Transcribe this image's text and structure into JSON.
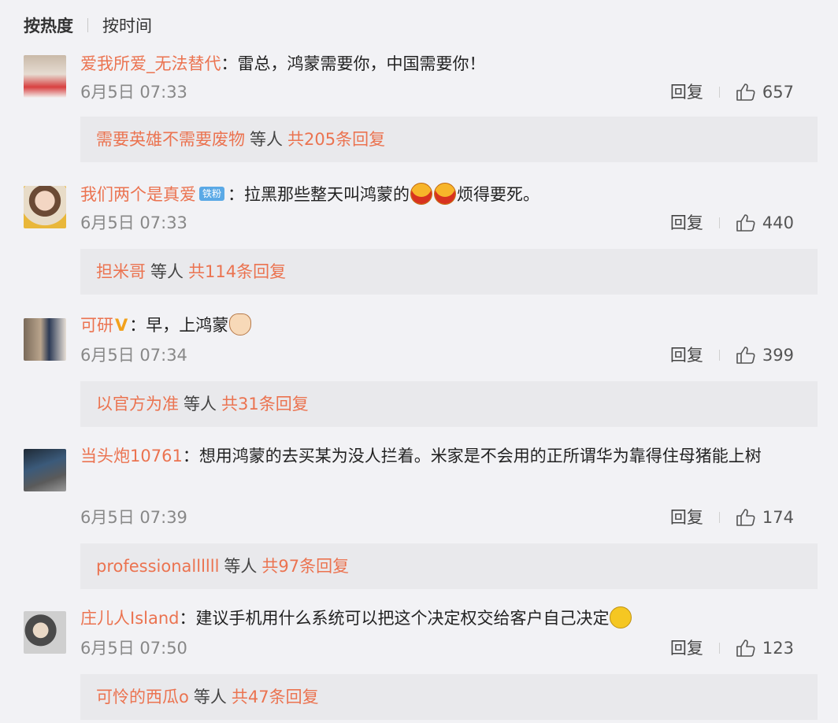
{
  "sort": {
    "hot_label": "按热度",
    "time_label": "按时间"
  },
  "comments": [
    {
      "username": "爱我所爱_无法替代",
      "colon": "：",
      "text": "雷总，鸿蒙需要你，中国需要你！",
      "text_after": "",
      "date": "6月5日 07:33",
      "reply_label": "回复",
      "likes": "657",
      "reply_user": "需要英雄不需要废物",
      "reply_mid": "等人",
      "reply_total": "共205条回复"
    },
    {
      "username": "我们两个是真爱",
      "badge": "铁粉",
      "colon": "：",
      "text": "拉黑那些整天叫鸿蒙的",
      "emojis": [
        "laugh-cry-emoji",
        "laugh-cry-emoji"
      ],
      "text_after": "烦得要死。",
      "date": "6月5日 07:33",
      "reply_label": "回复",
      "likes": "440",
      "reply_user": "担米哥",
      "reply_mid": "等人",
      "reply_total": "共114条回复"
    },
    {
      "username": "可研",
      "colon": "：",
      "text": "早，上鸿蒙",
      "emojis": [
        "cat-emoji"
      ],
      "text_after": "",
      "date": "6月5日 07:34",
      "reply_label": "回复",
      "likes": "399",
      "reply_user": "以官方为准",
      "reply_mid": "等人",
      "reply_total": "共31条回复"
    },
    {
      "username": "当头炮10761",
      "colon": "：",
      "text": "想用鸿蒙的去买某为没人拦着。米家是不会用的正所谓华为靠得住母猪能上树",
      "text_after": "",
      "date": "6月5日 07:39",
      "reply_label": "回复",
      "likes": "174",
      "reply_user": "professionallllll",
      "reply_mid": "等人",
      "reply_total": "共97条回复"
    },
    {
      "username": "庄儿人Island",
      "colon": "：",
      "text": "建议手机用什么系统可以把这个决定权交给客户自己决定",
      "emojis": [
        "smile-emoji"
      ],
      "text_after": "",
      "date": "6月5日 07:50",
      "reply_label": "回复",
      "likes": "123",
      "reply_user": "可怜的西瓜o",
      "reply_mid": "等人",
      "reply_total": "共47条回复"
    }
  ],
  "colors": {
    "accent": "#eb7350",
    "badge_blue": "#5aa9e6",
    "verified_gold": "#f2a11c"
  }
}
